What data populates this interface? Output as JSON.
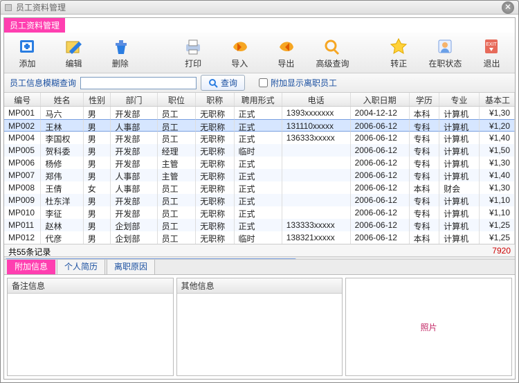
{
  "window": {
    "title": "员工资料管理"
  },
  "banner": "员工资料管理",
  "toolbar": {
    "add": "添加",
    "edit": "编辑",
    "delete": "删除",
    "print": "打印",
    "import": "导入",
    "export": "导出",
    "adv_query": "高级查询",
    "promote": "转正",
    "status": "在职状态",
    "exit": "退出"
  },
  "search": {
    "label": "员工信息模糊查询",
    "value": "",
    "button": "查询",
    "checkbox_label": "附加显示离职员工",
    "checked": false
  },
  "columns": [
    "编号",
    "姓名",
    "性别",
    "部门",
    "职位",
    "职称",
    "聘用形式",
    "电话",
    "入职日期",
    "学历",
    "专业",
    "基本工"
  ],
  "rows": [
    {
      "id": "MP001",
      "name": "马六",
      "sex": "男",
      "dept": "开发部",
      "pos": "员工",
      "title": "无职称",
      "form": "正式",
      "tel": "1393xxxxxxx",
      "date": "2004-12-12",
      "edu": "本科",
      "major": "计算机",
      "salary": "¥1,30"
    },
    {
      "id": "MP002",
      "name": "王林",
      "sex": "男",
      "dept": "人事部",
      "pos": "员工",
      "title": "无职称",
      "form": "正式",
      "tel": "131110xxxxx",
      "date": "2006-06-12",
      "edu": "专科",
      "major": "计算机",
      "salary": "¥1,20"
    },
    {
      "id": "MP004",
      "name": "李国权",
      "sex": "男",
      "dept": "开发部",
      "pos": "员工",
      "title": "无职称",
      "form": "正式",
      "tel": "136333xxxxx",
      "date": "2006-06-12",
      "edu": "专科",
      "major": "计算机",
      "salary": "¥1,40"
    },
    {
      "id": "MP005",
      "name": "贺科委",
      "sex": "男",
      "dept": "开发部",
      "pos": "经理",
      "title": "无职称",
      "form": "临时",
      "tel": "",
      "date": "2006-06-12",
      "edu": "专科",
      "major": "计算机",
      "salary": "¥1,50"
    },
    {
      "id": "MP006",
      "name": "杨修",
      "sex": "男",
      "dept": "开发部",
      "pos": "主管",
      "title": "无职称",
      "form": "正式",
      "tel": "",
      "date": "2006-06-12",
      "edu": "专科",
      "major": "计算机",
      "salary": "¥1,30"
    },
    {
      "id": "MP007",
      "name": "郑伟",
      "sex": "男",
      "dept": "人事部",
      "pos": "主管",
      "title": "无职称",
      "form": "正式",
      "tel": "",
      "date": "2006-06-12",
      "edu": "专科",
      "major": "计算机",
      "salary": "¥1,40"
    },
    {
      "id": "MP008",
      "name": "王倩",
      "sex": "女",
      "dept": "人事部",
      "pos": "员工",
      "title": "无职称",
      "form": "正式",
      "tel": "",
      "date": "2006-06-12",
      "edu": "本科",
      "major": "财会",
      "salary": "¥1,30"
    },
    {
      "id": "MP009",
      "name": "杜东洋",
      "sex": "男",
      "dept": "开发部",
      "pos": "员工",
      "title": "无职称",
      "form": "正式",
      "tel": "",
      "date": "2006-06-12",
      "edu": "专科",
      "major": "计算机",
      "salary": "¥1,10"
    },
    {
      "id": "MP010",
      "name": "李征",
      "sex": "男",
      "dept": "开发部",
      "pos": "员工",
      "title": "无职称",
      "form": "正式",
      "tel": "",
      "date": "2006-06-12",
      "edu": "专科",
      "major": "计算机",
      "salary": "¥1,10"
    },
    {
      "id": "MP011",
      "name": "赵林",
      "sex": "男",
      "dept": "企划部",
      "pos": "员工",
      "title": "无职称",
      "form": "正式",
      "tel": "133333xxxxx",
      "date": "2006-06-12",
      "edu": "专科",
      "major": "计算机",
      "salary": "¥1,25"
    },
    {
      "id": "MP012",
      "name": "代彦",
      "sex": "男",
      "dept": "企划部",
      "pos": "员工",
      "title": "无职称",
      "form": "临时",
      "tel": "138321xxxxx",
      "date": "2006-06-12",
      "edu": "本科",
      "major": "计算机",
      "salary": "¥1,25"
    }
  ],
  "selected_index": 1,
  "footer": {
    "count_label": "共55条记录",
    "sum": "7920"
  },
  "subtabs": {
    "extra": "附加信息",
    "resume": "个人简历",
    "leave_reason": "离职原因",
    "active": "extra"
  },
  "boxes": {
    "remark": "备注信息",
    "other": "其他信息",
    "photo": "照片"
  }
}
